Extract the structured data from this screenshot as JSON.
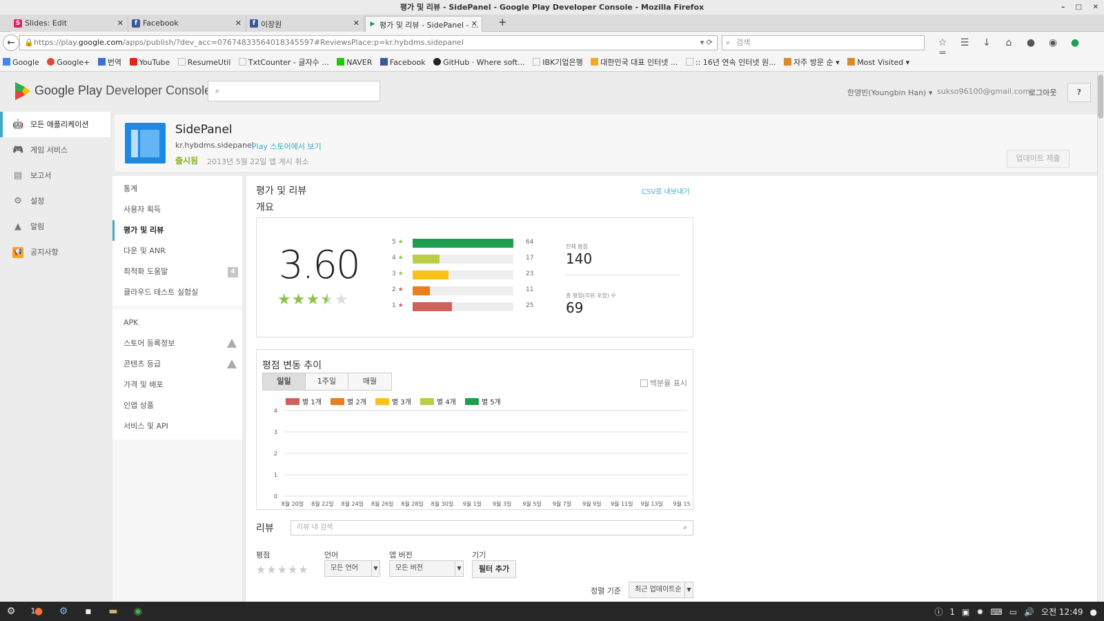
{
  "window": {
    "title": "평가 및 리뷰 - SidePanel - Google Play Developer Console - Mozilla Firefox"
  },
  "tabs": [
    {
      "label": "Slides: Edit",
      "favicon": "S",
      "color": "#e91e63"
    },
    {
      "label": "Facebook",
      "favicon": "f",
      "color": "#3b5998"
    },
    {
      "label": "이장원",
      "favicon": "f",
      "color": "#3b5998"
    },
    {
      "label": "평가 및 리뷰 - SidePanel - ...",
      "favicon": "▶",
      "color": "#ffffff"
    }
  ],
  "nav": {
    "url_prefix": "https://play.",
    "url_domain": "google.com",
    "url_rest": "/apps/publish/?dev_acc=07674833564018345597#ReviewsPlace:p=kr.hybdms.sidepanel",
    "search_placeholder": "검색"
  },
  "bookmarks": [
    "Google",
    "Google+",
    "번역",
    "YouTube",
    "ResumeUtil",
    "TxtCounter - 글자수 ...",
    "NAVER",
    "Facebook",
    "GitHub · Where soft...",
    "IBK기업은행",
    "대한민국 대표 인터넷 ...",
    ":: 16년 연속 인터넷 원...",
    "자주 방문 순 ▾",
    "Most Visited ▾"
  ],
  "console": {
    "title_a": "Google Play",
    "title_b": " Developer Console",
    "user": "한영빈(Youngbin Han) ▾",
    "email": "sukso96100@gmail.com",
    "logout": "로그아웃",
    "help": "?"
  },
  "leftnav": [
    {
      "label": "모든 애플리케이션",
      "icon": "android-icon"
    },
    {
      "label": "게임 서비스",
      "icon": "gamepad-icon"
    },
    {
      "label": "보고서",
      "icon": "database-icon"
    },
    {
      "label": "설정",
      "icon": "gear-icon"
    },
    {
      "label": "알림",
      "icon": "warning-icon"
    },
    {
      "label": "공지사항",
      "icon": "megaphone-icon"
    }
  ],
  "app": {
    "name": "SidePanel",
    "package": "kr.hybdms.sidepanel",
    "store_link": "Play 스토어에서 보기",
    "status": "출시됨",
    "date": "2013년 5월 22일",
    "unpublish": "앱 게시 취소",
    "update_button": "업데이트 제출"
  },
  "subnav": {
    "group1": [
      "통계",
      "사용자 획득",
      "평가 및 리뷰",
      "다운 및 ANR",
      "최적화 도움말",
      "클라우드 테스트 실험실"
    ],
    "optimize_badge": "4",
    "group2": [
      "APK",
      "스토어 등록정보",
      "콘텐츠 등급",
      "가격 및 배포",
      "인앱 상품",
      "서비스 및 API"
    ]
  },
  "ratings": {
    "title": "평가 및 리뷰",
    "subtitle": "개요",
    "csv": "CSV로 내보내기",
    "average": "3.60",
    "stars_filled": 3.5,
    "histogram": [
      {
        "star": "5",
        "count": 64,
        "color": "#1e9e50"
      },
      {
        "star": "4",
        "count": 17,
        "color": "#b8cf45"
      },
      {
        "star": "3",
        "count": 23,
        "color": "#fcc117"
      },
      {
        "star": "2",
        "count": 11,
        "color": "#ec7d1b"
      },
      {
        "star": "1",
        "count": 25,
        "color": "#d0605b"
      }
    ],
    "total_label": "전체 평점",
    "total_value": "140",
    "reviews_label": "총 평점(리뷰 포함) 수",
    "reviews_value": "69"
  },
  "trend": {
    "title": "평점 변동 추이",
    "periods": [
      "일일",
      "1주일",
      "매월"
    ],
    "percent_label": "백분율 표시"
  },
  "chart_data": {
    "type": "line",
    "x": [
      "8월 20일",
      "8월 22일",
      "8월 24일",
      "8월 26일",
      "8월 28일",
      "8월 30일",
      "9월 1일",
      "9월 3일",
      "9월 5일",
      "9월 7일",
      "9월 9일",
      "9월 11일",
      "9월 13일",
      "9월 15"
    ],
    "series": [
      {
        "name": "별 1개",
        "color": "#d0605b",
        "values": []
      },
      {
        "name": "별 2개",
        "color": "#ec7d1b",
        "values": []
      },
      {
        "name": "별 3개",
        "color": "#fcc117",
        "values": []
      },
      {
        "name": "별 4개",
        "color": "#b8cf45",
        "values": []
      },
      {
        "name": "별 5개",
        "color": "#1e9e50",
        "values": []
      }
    ],
    "yticks": [
      "0",
      "1",
      "2",
      "3",
      "4"
    ],
    "ylim": [
      0,
      4
    ],
    "grid": true,
    "legend": "top-left"
  },
  "reviews": {
    "label": "리뷰",
    "search_placeholder": "리뷰 내 검색",
    "rating_label": "평점",
    "language_label": "언어",
    "language_value": "모든 언어",
    "version_label": "앱 버전",
    "version_value": "모든 버전",
    "device_label": "기기",
    "filter_button": "필터 추가",
    "sort_label": "정렬 기준",
    "sort_value": "최근 업데이트순"
  },
  "taskbar": {
    "workspace": "1",
    "notify_count": "1",
    "clock": "오전 12:49"
  }
}
